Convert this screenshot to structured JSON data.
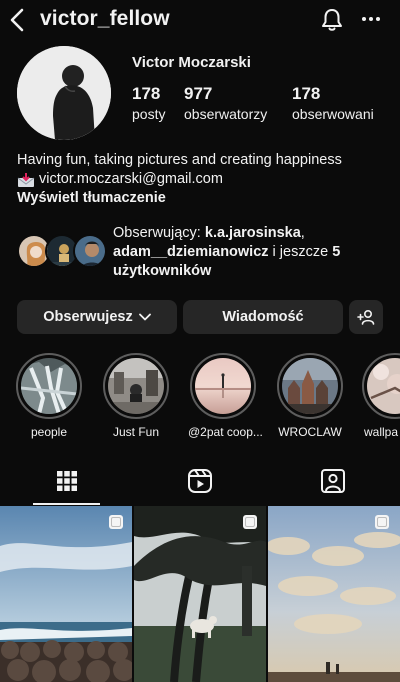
{
  "header": {
    "username": "victor_fellow",
    "back_icon": "chevron-left-icon",
    "notifications_icon": "bell-icon",
    "more_icon": "more-horizontal-icon"
  },
  "profile": {
    "full_name": "Victor Moczarski",
    "stats": [
      {
        "value": "178",
        "label": "posty"
      },
      {
        "value": "977",
        "label": "obserwatorzy"
      },
      {
        "value": "178",
        "label": "obserwowani"
      }
    ],
    "bio_line1": "Having fun, taking pictures and creating happiness",
    "email_icon": "incoming-envelope-emoji",
    "email": "victor.moczarski@gmail.com",
    "translate_link": "Wyświetl tłumaczenie"
  },
  "mutual_followers": {
    "prefix": "Obserwujący: ",
    "name1": "k.a.jarosinska",
    "separator": ", ",
    "name2": "adam__dziemianowicz",
    "connector": " i jeszcze ",
    "more": "5 użytkowników"
  },
  "actions": {
    "following": "Obserwujesz",
    "message": "Wiadomość",
    "add_user_icon": "add-person-icon"
  },
  "highlights": [
    {
      "label": "people"
    },
    {
      "label": "Just Fun"
    },
    {
      "label": "@2pat coop..."
    },
    {
      "label": "WROCLAW"
    },
    {
      "label": "wallpa"
    }
  ],
  "tabs": [
    {
      "name": "posts-grid",
      "icon": "grid-icon",
      "active": true
    },
    {
      "name": "reels",
      "icon": "reels-icon",
      "active": false
    },
    {
      "name": "tagged",
      "icon": "tagged-person-icon",
      "active": false
    }
  ],
  "posts": [
    {
      "type": "carousel"
    },
    {
      "type": "carousel"
    },
    {
      "type": "carousel"
    }
  ],
  "colors": {
    "background": "#0b0b0b",
    "button": "#262626",
    "text": "#f2f2f2",
    "highlight_ring": "#5d5d5d"
  }
}
